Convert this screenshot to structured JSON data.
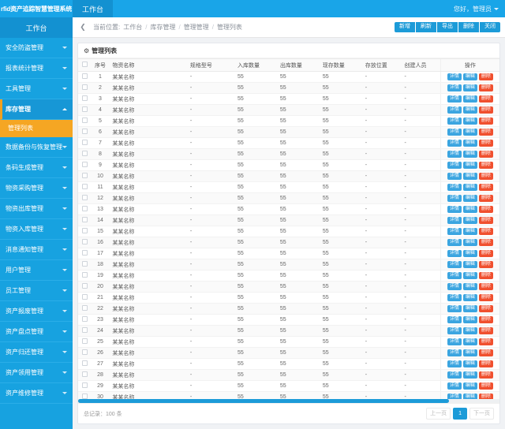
{
  "header": {
    "brand": "rfid资产追踪智慧管理系统",
    "tabs": [
      {
        "label": "工作台"
      }
    ],
    "user_greeting": "您好，管理员"
  },
  "sidebar": {
    "title": "工作台",
    "items": [
      {
        "label": "安全防盗管理",
        "active": false
      },
      {
        "label": "报表统计管理",
        "active": false
      },
      {
        "label": "工具管理",
        "active": false
      },
      {
        "label": "库存管理",
        "active": true
      },
      {
        "label": "数据备份与恢复管理",
        "active": false
      },
      {
        "label": "条码生成管理",
        "active": false
      },
      {
        "label": "物资采购管理",
        "active": false
      },
      {
        "label": "物资出库管理",
        "active": false
      },
      {
        "label": "物资入库管理",
        "active": false
      },
      {
        "label": "消息通知管理",
        "active": false
      },
      {
        "label": "用户管理",
        "active": false
      },
      {
        "label": "员工管理",
        "active": false
      },
      {
        "label": "资产报废管理",
        "active": false
      },
      {
        "label": "资产盘点管理",
        "active": false
      },
      {
        "label": "资产归还管理",
        "active": false
      },
      {
        "label": "资产领用管理",
        "active": false
      },
      {
        "label": "资产维修管理",
        "active": false
      }
    ],
    "sub_item": "管理列表"
  },
  "breadcrumb": {
    "collapse_icon": "chevron-left-icon",
    "prefix": "当前位置:",
    "path": [
      "工作台",
      "库存管理",
      "管理管理",
      "管理列表"
    ],
    "separator": "/",
    "actions": [
      "新增",
      "刷新",
      "导出",
      "删除",
      "关闭"
    ]
  },
  "card": {
    "icon": "gear-icon",
    "title": "管理列表"
  },
  "table": {
    "columns": [
      "序号",
      "物资名称",
      "规格型号",
      "入库数量",
      "出库数量",
      "现存数量",
      "存放位置",
      "创建人员",
      "操作"
    ],
    "row_actions": [
      "详情",
      "编辑",
      "删除"
    ],
    "rows": [
      {
        "idx": "1",
        "name": "某某名称",
        "spec": "-",
        "in": "55",
        "out": "55",
        "stock": "55",
        "loc": "-",
        "user": "-"
      },
      {
        "idx": "2",
        "name": "某某名称",
        "spec": "-",
        "in": "55",
        "out": "55",
        "stock": "55",
        "loc": "-",
        "user": "-"
      },
      {
        "idx": "3",
        "name": "某某名称",
        "spec": "-",
        "in": "55",
        "out": "55",
        "stock": "55",
        "loc": "-",
        "user": "-"
      },
      {
        "idx": "4",
        "name": "某某名称",
        "spec": "-",
        "in": "55",
        "out": "55",
        "stock": "55",
        "loc": "-",
        "user": "-"
      },
      {
        "idx": "5",
        "name": "某某名称",
        "spec": "-",
        "in": "55",
        "out": "55",
        "stock": "55",
        "loc": "-",
        "user": "-"
      },
      {
        "idx": "6",
        "name": "某某名称",
        "spec": "-",
        "in": "55",
        "out": "55",
        "stock": "55",
        "loc": "-",
        "user": "-"
      },
      {
        "idx": "7",
        "name": "某某名称",
        "spec": "-",
        "in": "55",
        "out": "55",
        "stock": "55",
        "loc": "-",
        "user": "-"
      },
      {
        "idx": "8",
        "name": "某某名称",
        "spec": "-",
        "in": "55",
        "out": "55",
        "stock": "55",
        "loc": "-",
        "user": "-"
      },
      {
        "idx": "9",
        "name": "某某名称",
        "spec": "-",
        "in": "55",
        "out": "55",
        "stock": "55",
        "loc": "-",
        "user": "-"
      },
      {
        "idx": "10",
        "name": "某某名称",
        "spec": "-",
        "in": "55",
        "out": "55",
        "stock": "55",
        "loc": "-",
        "user": "-"
      },
      {
        "idx": "11",
        "name": "某某名称",
        "spec": "-",
        "in": "55",
        "out": "55",
        "stock": "55",
        "loc": "-",
        "user": "-"
      },
      {
        "idx": "12",
        "name": "某某名称",
        "spec": "-",
        "in": "55",
        "out": "55",
        "stock": "55",
        "loc": "-",
        "user": "-"
      },
      {
        "idx": "13",
        "name": "某某名称",
        "spec": "-",
        "in": "55",
        "out": "55",
        "stock": "55",
        "loc": "-",
        "user": "-"
      },
      {
        "idx": "14",
        "name": "某某名称",
        "spec": "-",
        "in": "55",
        "out": "55",
        "stock": "55",
        "loc": "-",
        "user": "-"
      },
      {
        "idx": "15",
        "name": "某某名称",
        "spec": "-",
        "in": "55",
        "out": "55",
        "stock": "55",
        "loc": "-",
        "user": "-"
      },
      {
        "idx": "16",
        "name": "某某名称",
        "spec": "-",
        "in": "55",
        "out": "55",
        "stock": "55",
        "loc": "-",
        "user": "-"
      },
      {
        "idx": "17",
        "name": "某某名称",
        "spec": "-",
        "in": "55",
        "out": "55",
        "stock": "55",
        "loc": "-",
        "user": "-"
      },
      {
        "idx": "18",
        "name": "某某名称",
        "spec": "-",
        "in": "55",
        "out": "55",
        "stock": "55",
        "loc": "-",
        "user": "-"
      },
      {
        "idx": "19",
        "name": "某某名称",
        "spec": "-",
        "in": "55",
        "out": "55",
        "stock": "55",
        "loc": "-",
        "user": "-"
      },
      {
        "idx": "20",
        "name": "某某名称",
        "spec": "-",
        "in": "55",
        "out": "55",
        "stock": "55",
        "loc": "-",
        "user": "-"
      },
      {
        "idx": "21",
        "name": "某某名称",
        "spec": "-",
        "in": "55",
        "out": "55",
        "stock": "55",
        "loc": "-",
        "user": "-"
      },
      {
        "idx": "22",
        "name": "某某名称",
        "spec": "-",
        "in": "55",
        "out": "55",
        "stock": "55",
        "loc": "-",
        "user": "-"
      },
      {
        "idx": "23",
        "name": "某某名称",
        "spec": "-",
        "in": "55",
        "out": "55",
        "stock": "55",
        "loc": "-",
        "user": "-"
      },
      {
        "idx": "24",
        "name": "某某名称",
        "spec": "-",
        "in": "55",
        "out": "55",
        "stock": "55",
        "loc": "-",
        "user": "-"
      },
      {
        "idx": "25",
        "name": "某某名称",
        "spec": "-",
        "in": "55",
        "out": "55",
        "stock": "55",
        "loc": "-",
        "user": "-"
      },
      {
        "idx": "26",
        "name": "某某名称",
        "spec": "-",
        "in": "55",
        "out": "55",
        "stock": "55",
        "loc": "-",
        "user": "-"
      },
      {
        "idx": "27",
        "name": "某某名称",
        "spec": "-",
        "in": "55",
        "out": "55",
        "stock": "55",
        "loc": "-",
        "user": "-"
      },
      {
        "idx": "28",
        "name": "某某名称",
        "spec": "-",
        "in": "55",
        "out": "55",
        "stock": "55",
        "loc": "-",
        "user": "-"
      },
      {
        "idx": "29",
        "name": "某某名称",
        "spec": "-",
        "in": "55",
        "out": "55",
        "stock": "55",
        "loc": "-",
        "user": "-"
      },
      {
        "idx": "30",
        "name": "某某名称",
        "spec": "-",
        "in": "55",
        "out": "55",
        "stock": "55",
        "loc": "-",
        "user": "-"
      }
    ]
  },
  "footer": {
    "total_text": "总记录：100 条",
    "prev_label": "上一页",
    "current_page": "1",
    "next_label": "下一页"
  },
  "colors": {
    "brand_blue": "#19A5E8",
    "sidebar_blue": "#17A2E0",
    "accent_orange": "#F5A623",
    "button_blue": "#1C9BD8",
    "danger_red": "#F0502F"
  }
}
